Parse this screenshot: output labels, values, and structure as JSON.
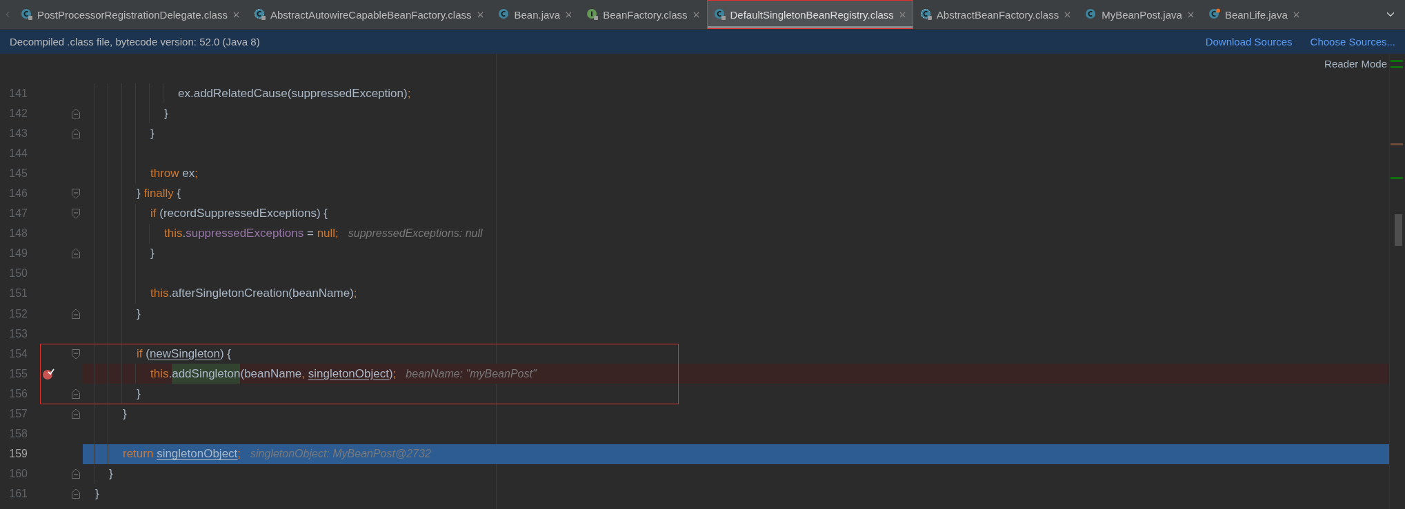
{
  "tabs": [
    {
      "label": "PostProcessorRegistrationDelegate.class",
      "kind": "library",
      "selected": false,
      "boxed": false
    },
    {
      "label": "AbstractAutowireCapableBeanFactory.class",
      "kind": "abstract",
      "selected": false,
      "boxed": false
    },
    {
      "label": "Bean.java",
      "kind": "source",
      "selected": false,
      "boxed": false
    },
    {
      "label": "BeanFactory.class",
      "kind": "interface",
      "selected": false,
      "boxed": false
    },
    {
      "label": "DefaultSingletonBeanRegistry.class",
      "kind": "library",
      "selected": true,
      "boxed": true
    },
    {
      "label": "AbstractBeanFactory.class",
      "kind": "abstract",
      "selected": false,
      "boxed": false
    },
    {
      "label": "MyBeanPost.java",
      "kind": "source",
      "selected": false,
      "boxed": false
    },
    {
      "label": "BeanLife.java",
      "kind": "runnable",
      "selected": false,
      "boxed": false
    }
  ],
  "banner": {
    "text": "Decompiled .class file, bytecode version: 52.0 (Java 8)",
    "links": [
      "Download Sources",
      "Choose Sources..."
    ]
  },
  "editor": {
    "reader_mode": "Reader Mode",
    "lines": [
      {
        "children": [
          {
            "children": [
              {
                "children": [
                  {
                    "children": [
                      {
                        "children": [
                          {
                            "children": [
                              {
                                "number": "141",
                                "tokens": [
                                  {
                                    "kind": "plain",
                                    "text": "ex.addRelatedCause(suppressedException)"
                                  },
                                  {
                                    "kind": "keyword",
                                    "text": ";"
                                  }
                                ],
                                "breakpoint": false,
                                "current": false,
                                "boxed": false
                              }
                            ]
                          },
                          {
                            "number": "142",
                            "kind": "closer",
                            "tokens": [
                              {
                                "kind": "plain",
                                "text": "}"
                              }
                            ],
                            "breakpoint": false,
                            "current": false,
                            "boxed": false
                          }
                        ]
                      },
                      {
                        "number": "143",
                        "kind": "closer",
                        "tokens": [
                          {
                            "kind": "plain",
                            "text": "}"
                          }
                        ],
                        "breakpoint": false,
                        "current": false,
                        "boxed": false
                      },
                      {
                        "number": "144",
                        "breakpoint": false,
                        "current": false,
                        "boxed": false
                      },
                      {
                        "number": "145",
                        "tokens": [
                          {
                            "kind": "keyword",
                            "text": "throw"
                          },
                          {
                            "kind": "plain",
                            "text": " ex"
                          },
                          {
                            "kind": "keyword",
                            "text": ";"
                          }
                        ],
                        "breakpoint": false,
                        "current": false,
                        "boxed": false
                      }
                    ]
                  },
                  {
                    "number": "146",
                    "kind": "opener",
                    "tokens": [
                      {
                        "kind": "plain",
                        "text": "} "
                      },
                      {
                        "kind": "keyword",
                        "text": "finally"
                      },
                      {
                        "kind": "plain",
                        "text": " {"
                      }
                    ],
                    "breakpoint": false,
                    "current": false,
                    "boxed": false
                  },
                  {
                    "children": [
                      {
                        "number": "147",
                        "kind": "opener",
                        "tokens": [
                          {
                            "kind": "keyword",
                            "text": "if"
                          },
                          {
                            "kind": "plain",
                            "text": " (recordSuppressedExceptions) {"
                          }
                        ],
                        "breakpoint": false,
                        "current": false,
                        "boxed": false
                      },
                      {
                        "children": [
                          {
                            "number": "148",
                            "tokens": [
                              {
                                "kind": "keyword",
                                "text": "this"
                              },
                              {
                                "kind": "plain",
                                "text": "."
                              },
                              {
                                "kind": "field",
                                "text": "suppressedExceptions"
                              },
                              {
                                "kind": "plain",
                                "text": " = "
                              },
                              {
                                "kind": "keyword",
                                "text": "null;"
                              }
                            ],
                            "hint": "suppressedExceptions: null",
                            "breakpoint": false,
                            "current": false,
                            "boxed": false
                          }
                        ]
                      },
                      {
                        "number": "149",
                        "kind": "closer",
                        "tokens": [
                          {
                            "kind": "plain",
                            "text": "}"
                          }
                        ],
                        "breakpoint": false,
                        "current": false,
                        "boxed": false
                      },
                      {
                        "number": "150",
                        "breakpoint": false,
                        "current": false,
                        "boxed": false
                      },
                      {
                        "number": "151",
                        "tokens": [
                          {
                            "kind": "keyword",
                            "text": "this"
                          },
                          {
                            "kind": "plain",
                            "text": ".afterSingletonCreation(beanName)"
                          },
                          {
                            "kind": "keyword",
                            "text": ";"
                          }
                        ],
                        "breakpoint": false,
                        "current": false,
                        "boxed": false
                      }
                    ]
                  },
                  {
                    "number": "152",
                    "kind": "closer",
                    "tokens": [
                      {
                        "kind": "plain",
                        "text": "}"
                      }
                    ],
                    "breakpoint": false,
                    "current": false,
                    "boxed": false
                  },
                  {
                    "number": "153",
                    "breakpoint": false,
                    "current": false,
                    "boxed": false
                  },
                  {
                    "number": "154",
                    "kind": "opener",
                    "tokens": [
                      {
                        "kind": "keyword",
                        "text": "if"
                      },
                      {
                        "kind": "plain",
                        "text": " ("
                      },
                      {
                        "kind": "variable",
                        "text": "newSingleton"
                      },
                      {
                        "kind": "plain",
                        "text": ") {"
                      }
                    ],
                    "breakpoint": false,
                    "current": false,
                    "boxed": true
                  },
                  {
                    "children": [
                      {
                        "number": "155",
                        "tokens": [
                          {
                            "kind": "keyword",
                            "text": "this"
                          },
                          {
                            "kind": "plain",
                            "text": "."
                          },
                          {
                            "kind": "highlighted",
                            "text": "addSingleton"
                          },
                          {
                            "kind": "plain",
                            "text": "(beanName"
                          },
                          {
                            "kind": "keyword",
                            "text": ", "
                          },
                          {
                            "kind": "variable",
                            "text": "singletonObject"
                          },
                          {
                            "kind": "plain",
                            "text": ")"
                          },
                          {
                            "kind": "keyword",
                            "text": ";"
                          }
                        ],
                        "hint": "beanName: \"myBeanPost\"",
                        "breakpoint": true,
                        "current": false,
                        "boxed": true
                      }
                    ]
                  },
                  {
                    "number": "156",
                    "kind": "closer",
                    "tokens": [
                      {
                        "kind": "plain",
                        "text": "}"
                      }
                    ],
                    "breakpoint": false,
                    "current": false,
                    "boxed": true
                  }
                ]
              },
              {
                "number": "157",
                "kind": "closer",
                "tokens": [
                  {
                    "kind": "plain",
                    "text": "}"
                  }
                ],
                "breakpoint": false,
                "current": false,
                "boxed": false
              },
              {
                "number": "158",
                "breakpoint": false,
                "current": false,
                "boxed": false
              },
              {
                "number": "159",
                "tokens": [
                  {
                    "kind": "keyword",
                    "text": "return "
                  },
                  {
                    "kind": "variable",
                    "text": "singletonObject"
                  },
                  {
                    "kind": "keyword",
                    "text": ";"
                  }
                ],
                "hint": "singletonObject: MyBeanPost@2732",
                "breakpoint": false,
                "current": true,
                "boxed": false
              }
            ]
          },
          {
            "number": "160",
            "kind": "closer",
            "tokens": [
              {
                "kind": "plain",
                "text": "}"
              }
            ],
            "breakpoint": false,
            "current": false,
            "boxed": false
          }
        ]
      },
      {
        "number": "161",
        "kind": "closer",
        "tokens": [
          {
            "kind": "plain",
            "text": "}"
          }
        ],
        "breakpoint": false,
        "current": false,
        "boxed": false
      }
    ]
  }
}
